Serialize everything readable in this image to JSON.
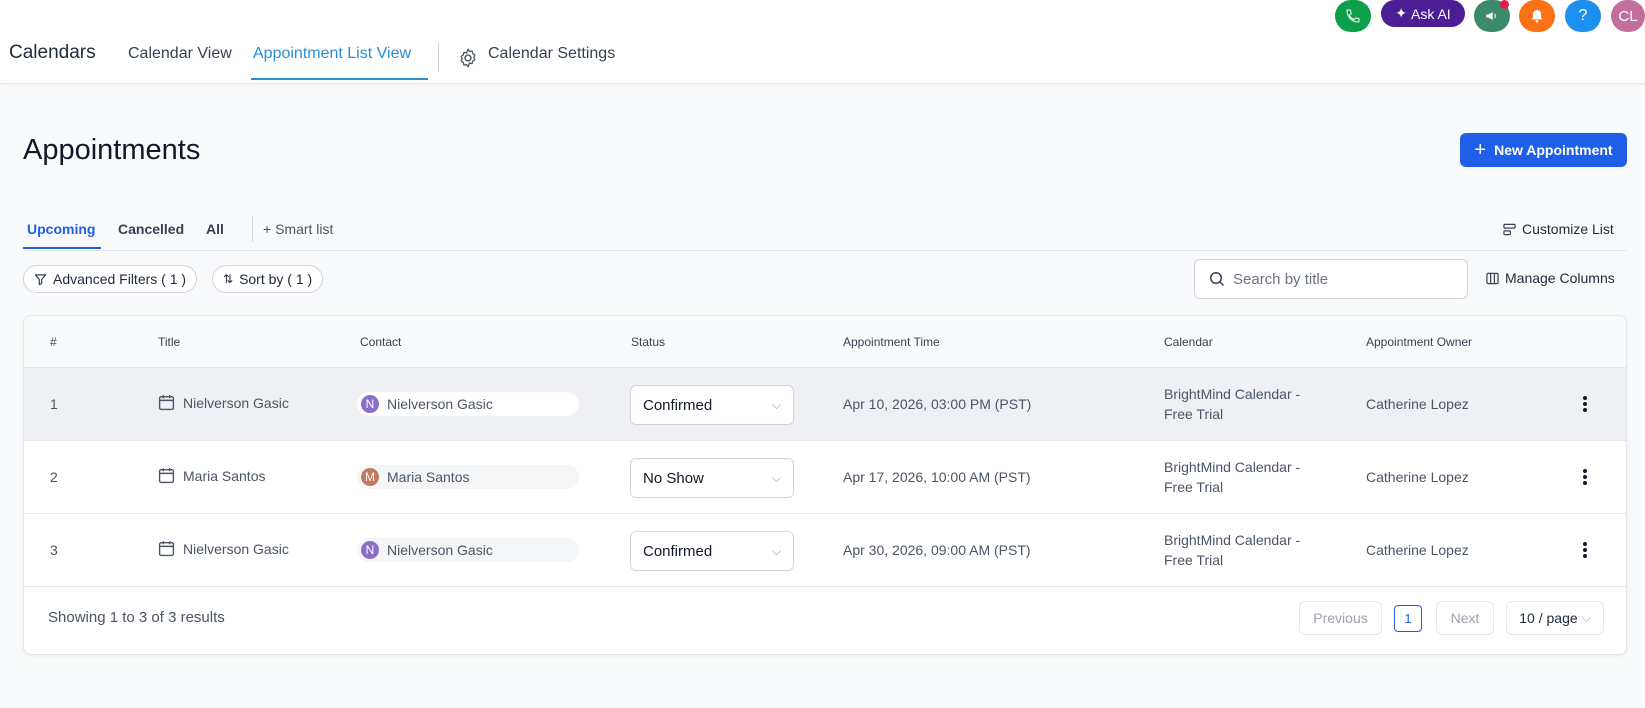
{
  "header": {
    "brand": "Calendars",
    "tabs": [
      {
        "label": "Calendar View"
      },
      {
        "label": "Appointment List View"
      },
      {
        "label": "Calendar Settings"
      }
    ],
    "ask_ai_label": "Ask AI",
    "help_label": "?",
    "user_initials": "CL"
  },
  "page": {
    "title": "Appointments",
    "new_button_label": "New Appointment"
  },
  "subtabs": {
    "items": [
      {
        "label": "Upcoming"
      },
      {
        "label": "Cancelled"
      },
      {
        "label": "All"
      }
    ],
    "smart_list_label": "Smart list",
    "customize_label": "Customize List"
  },
  "filters": {
    "advanced_label": "Advanced Filters ( 1 )",
    "sort_label": "Sort by ( 1 )",
    "search_placeholder": "Search by title",
    "manage_columns_label": "Manage Columns"
  },
  "table": {
    "columns": [
      "#",
      "Title",
      "Contact",
      "Status",
      "Appointment Time",
      "Calendar",
      "Appointment Owner"
    ],
    "rows": [
      {
        "num": "1",
        "title": "Nielverson Gasic",
        "contact": "Nielverson Gasic",
        "initial": "N",
        "status": "Confirmed",
        "time": "Apr 10, 2026, 03:00 PM (PST)",
        "calendar_line1": "BrightMind Calendar -",
        "calendar_line2": "Free Trial",
        "owner": "Catherine Lopez"
      },
      {
        "num": "2",
        "title": "Maria Santos",
        "contact": "Maria Santos",
        "initial": "M",
        "status": "No Show",
        "time": "Apr 17, 2026, 10:00 AM (PST)",
        "calendar_line1": "BrightMind Calendar -",
        "calendar_line2": "Free Trial",
        "owner": "Catherine Lopez"
      },
      {
        "num": "3",
        "title": "Nielverson Gasic",
        "contact": "Nielverson Gasic",
        "initial": "N",
        "status": "Confirmed",
        "time": "Apr 30, 2026, 09:00 AM (PST)",
        "calendar_line1": "BrightMind Calendar -",
        "calendar_line2": "Free Trial",
        "owner": "Catherine Lopez"
      }
    ]
  },
  "pagination": {
    "summary": "Showing 1 to 3 of 3 results",
    "previous_label": "Previous",
    "current_page": "1",
    "next_label": "Next",
    "per_page_label": "10 / page"
  },
  "colors": {
    "primary": "#1f5fe8",
    "nav_active": "#2a8fd0",
    "phone_green": "#0d9f4a",
    "ask_ai_purple": "#4c1d95",
    "megaphone_teal": "#3b8a6b",
    "bell_orange": "#f97316",
    "help_blue": "#1d8fef",
    "avatar_pink": "#c36f9e",
    "avatar_n": "#8b6fc7",
    "avatar_m": "#c27a63"
  }
}
